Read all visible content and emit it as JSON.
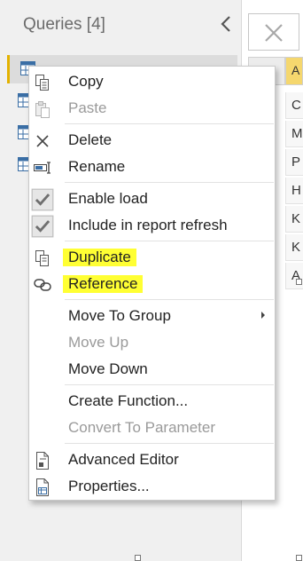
{
  "queries_pane": {
    "title": "Queries [4]"
  },
  "grid": {
    "column_header_text": "A",
    "cells": [
      "C",
      "M",
      "P",
      "H",
      "K",
      "K",
      "A"
    ]
  },
  "context_menu": {
    "items": [
      {
        "label": "Copy",
        "icon": "copy-icon",
        "enabled": true
      },
      {
        "label": "Paste",
        "icon": "paste-icon",
        "enabled": false
      },
      {
        "label": "Delete",
        "icon": "delete-icon",
        "enabled": true
      },
      {
        "label": "Rename",
        "icon": "rename-icon",
        "enabled": true
      },
      {
        "label": "Enable load",
        "icon": "checkbox-checked-icon",
        "enabled": true,
        "checked": true
      },
      {
        "label": "Include in report refresh",
        "icon": "checkbox-checked-icon",
        "enabled": true,
        "checked": true
      },
      {
        "label": "Duplicate",
        "icon": "duplicate-icon",
        "enabled": true,
        "highlighted": true
      },
      {
        "label": "Reference",
        "icon": "reference-icon",
        "enabled": true,
        "highlighted": true
      },
      {
        "label": "Move To Group",
        "icon": "",
        "enabled": true,
        "submenu": true
      },
      {
        "label": "Move Up",
        "icon": "",
        "enabled": false
      },
      {
        "label": "Move Down",
        "icon": "",
        "enabled": true
      },
      {
        "label": "Create Function...",
        "icon": "",
        "enabled": true
      },
      {
        "label": "Convert To Parameter",
        "icon": "",
        "enabled": false
      },
      {
        "label": "Advanced Editor",
        "icon": "advanced-editor-icon",
        "enabled": true
      },
      {
        "label": "Properties...",
        "icon": "properties-icon",
        "enabled": true
      }
    ]
  },
  "colors": {
    "highlight": "#ffff33",
    "selected_accent": "#e3b200",
    "disabled_text": "#9a9a9a",
    "check_gray": "#7a7a7a"
  }
}
